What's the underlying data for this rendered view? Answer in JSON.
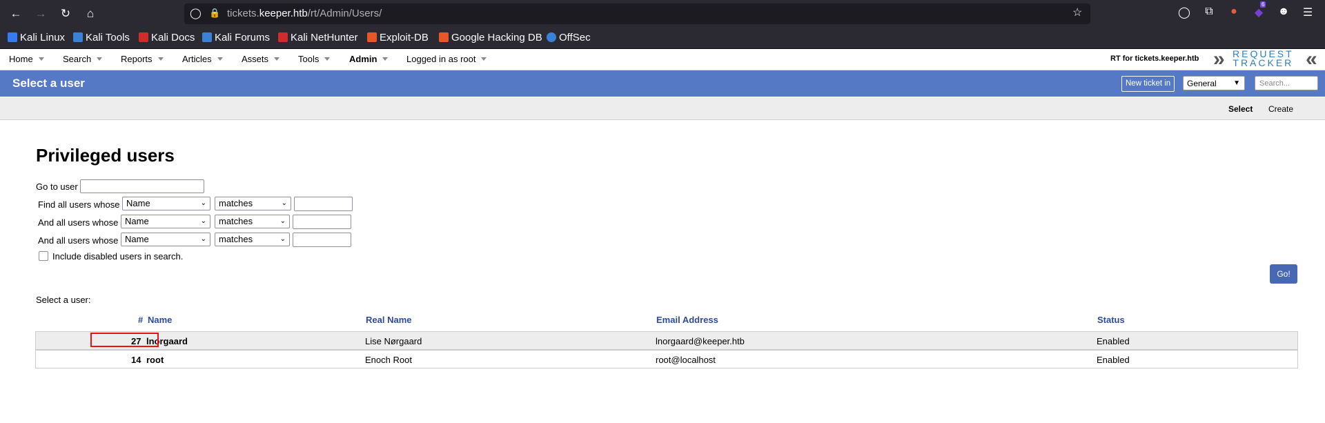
{
  "browser": {
    "url_host_prefix": "tickets.",
    "url_domain": "keeper.htb",
    "url_path": "/rt/Admin/Users/",
    "extensions_badge": "6"
  },
  "bookmarks": [
    {
      "label": "Kali Linux",
      "color": "#367bf0"
    },
    {
      "label": "Kali Tools",
      "color": "#3b82d6"
    },
    {
      "label": "Kali Docs",
      "color": "#d22b2b"
    },
    {
      "label": "Kali Forums",
      "color": "#3b82d6"
    },
    {
      "label": "Kali NetHunter",
      "color": "#d22b2b"
    },
    {
      "label": "Exploit-DB",
      "color": "#e8572a"
    },
    {
      "label": "Google Hacking DB",
      "color": "#e8572a"
    },
    {
      "label": "OffSec",
      "color": "#3b82d6"
    }
  ],
  "menu": {
    "items": [
      "Home",
      "Search",
      "Reports",
      "Articles",
      "Assets",
      "Tools",
      "Admin",
      "Logged in as root"
    ],
    "rt_for": "RT for tickets.keeper.htb",
    "logo_line1": "REQUEST",
    "logo_line2": "TRACKER"
  },
  "header": {
    "title": "Select a user",
    "new_ticket_label": "New ticket in",
    "queue_value": "General",
    "search_placeholder": "Search..."
  },
  "subnav": {
    "select": "Select",
    "create": "Create"
  },
  "main": {
    "heading": "Privileged users",
    "go_to_user_label": "Go to user",
    "filters": [
      {
        "label": "Find all users whose",
        "field": "Name",
        "op": "matches"
      },
      {
        "label": "And all users whose",
        "field": "Name",
        "op": "matches"
      },
      {
        "label": "And all users whose",
        "field": "Name",
        "op": "matches"
      }
    ],
    "include_disabled_label": "Include disabled users in search.",
    "go_label": "Go!",
    "select_user_label": "Select a user:"
  },
  "table": {
    "headers": {
      "id": "#",
      "name": "Name",
      "real_name": "Real Name",
      "email": "Email Address",
      "status": "Status"
    },
    "rows": [
      {
        "id": "27",
        "name": "lnorgaard",
        "real_name": "Lise Nørgaard",
        "email": "lnorgaard@keeper.htb",
        "status": "Enabled"
      },
      {
        "id": "14",
        "name": "root",
        "real_name": "Enoch Root",
        "email": "root@localhost",
        "status": "Enabled"
      }
    ]
  }
}
